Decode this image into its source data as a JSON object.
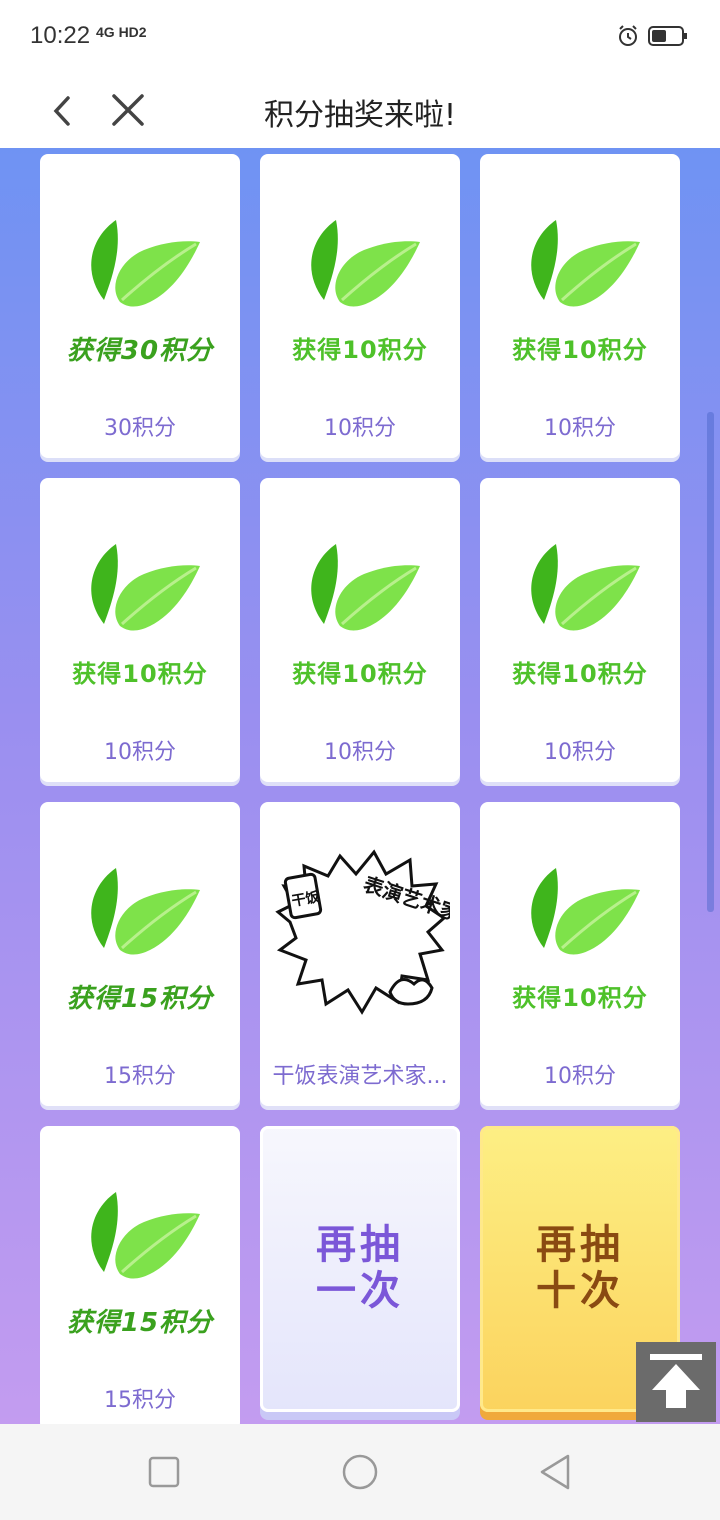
{
  "status": {
    "time": "10:22",
    "network": "4G HD2"
  },
  "nav": {
    "title": "积分抽奖来啦!"
  },
  "cards": [
    {
      "caption": "获得30积分",
      "label": "30积分"
    },
    {
      "caption": "获得10积分",
      "label": "10积分"
    },
    {
      "caption": "获得10积分",
      "label": "10积分"
    },
    {
      "caption": "获得10积分",
      "label": "10积分"
    },
    {
      "caption": "获得10积分",
      "label": "10积分"
    },
    {
      "caption": "获得10积分",
      "label": "10积分"
    },
    {
      "caption": "获得15积分",
      "label": "15积分"
    },
    {
      "caption": "",
      "label": "干饭表演艺术家...",
      "image_text_1": "表演艺术家",
      "image_text_2": "干饭"
    },
    {
      "caption": "获得10积分",
      "label": "10积分"
    },
    {
      "caption": "获得15积分",
      "label": "15积分"
    }
  ],
  "buttons": {
    "once": {
      "line1": "再抽",
      "line2": "一次"
    },
    "ten": {
      "line1": "再抽",
      "line2": "十次"
    }
  },
  "colors": {
    "leaf_dark": "#3fb51c",
    "leaf_light": "#7ee24a",
    "label": "#7d6bd0",
    "gradient_top": "#6f93f3",
    "gradient_bottom": "#c39cf0"
  },
  "icons": {
    "back": "chevron-left-icon",
    "close": "close-icon",
    "back_to_top": "arrow-up-icon"
  }
}
